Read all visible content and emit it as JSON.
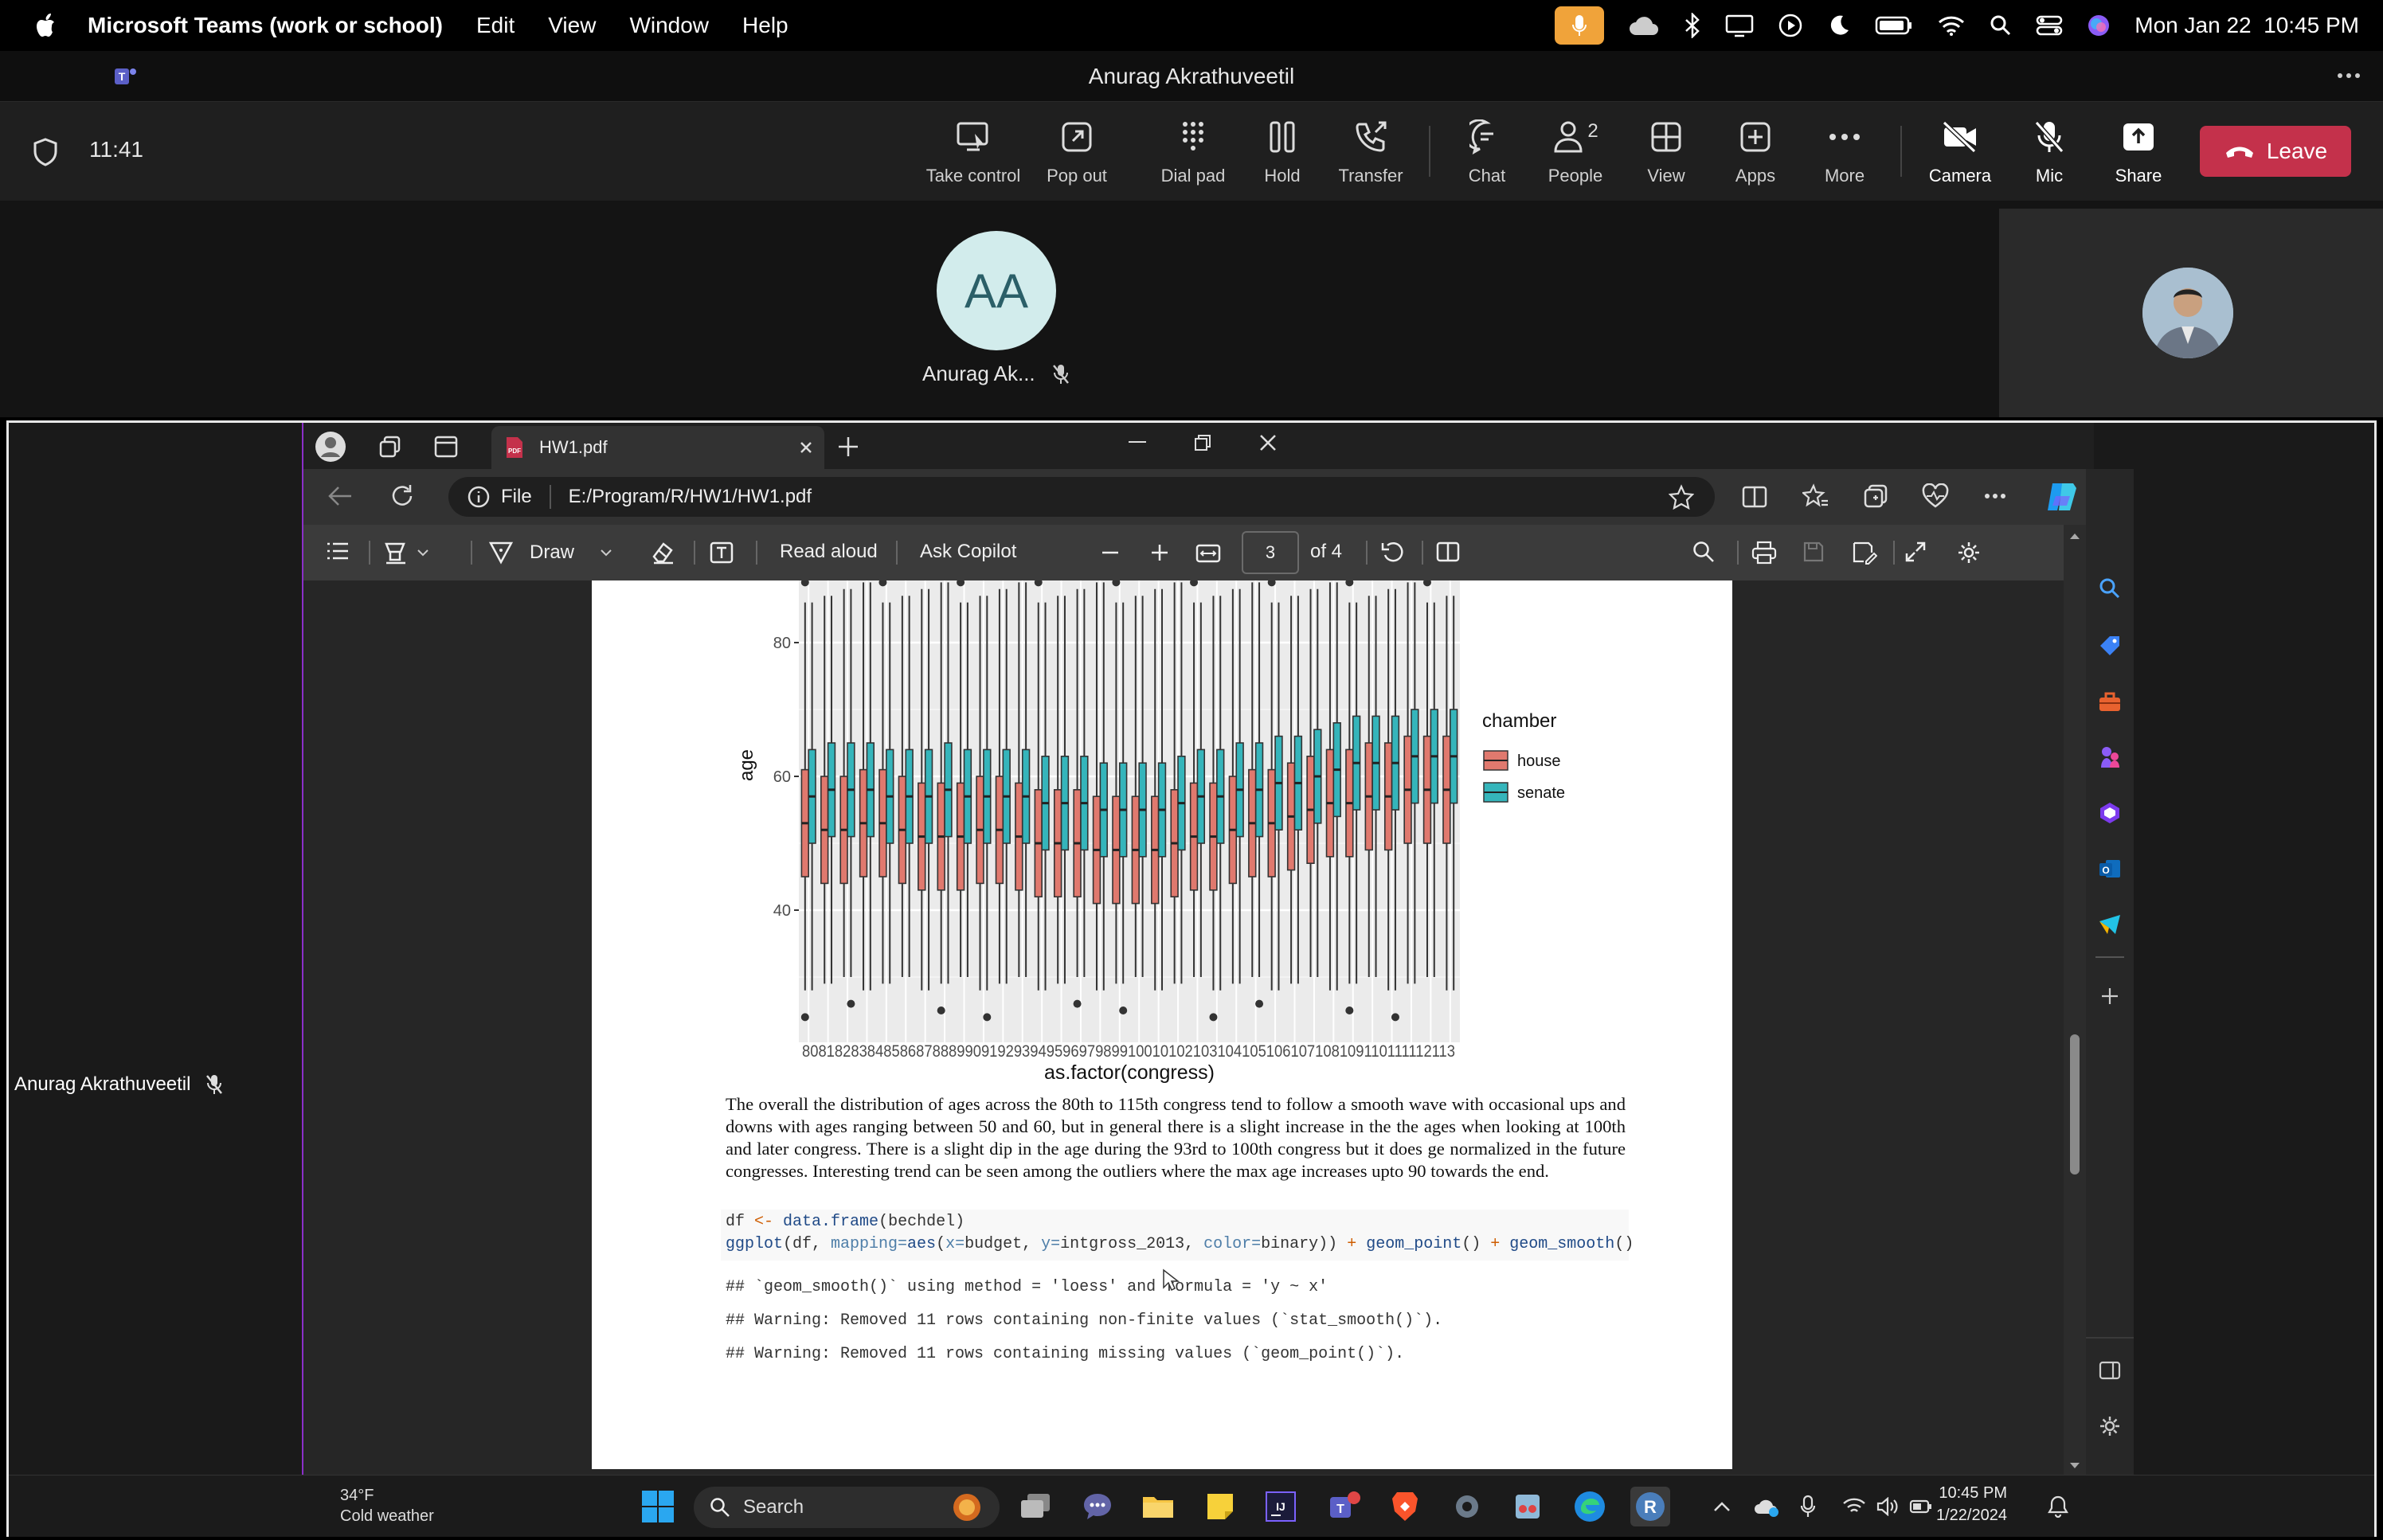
{
  "menubar": {
    "app_name": "Microsoft Teams (work or school)",
    "menus": [
      "Edit",
      "View",
      "Window",
      "Help"
    ],
    "datetime": "Mon Jan 22  10:45 PM"
  },
  "window": {
    "title": "Anurag Akrathuveetil"
  },
  "meeting": {
    "elapsed": "11:41",
    "controls": {
      "take_control": "Take control",
      "pop_out": "Pop out",
      "dial_pad": "Dial pad",
      "hold": "Hold",
      "transfer": "Transfer",
      "chat": "Chat",
      "people": "People",
      "people_count": "2",
      "view": "View",
      "apps": "Apps",
      "more": "More",
      "camera": "Camera",
      "mic": "Mic",
      "share": "Share",
      "leave": "Leave"
    },
    "participant": {
      "initials": "AA",
      "name": "Anurag Ak..."
    },
    "presenter_name": "Anurag Akrathuveetil"
  },
  "browser": {
    "tab_title": "HW1.pdf",
    "address_prefix": "File",
    "address": "E:/Program/R/HW1/HW1.pdf",
    "pdf_toolbar": {
      "draw": "Draw",
      "read_aloud": "Read aloud",
      "ask_copilot": "Ask Copilot",
      "page_current": "3",
      "page_total": "of 4"
    }
  },
  "document": {
    "paragraph": "The overall the distribution of ages across the 80th to 115th congress tend to follow a smooth wave with occasional ups and downs with ages ranging between 50 and 60, but in general there is a slight increase in the the ages when looking at 100th and later congress. There is a slight dip in the age during the 93rd to 100th congress but it does ge normalized in the future congresses. Interesting trend can be seen among the outliers where the max age increases upto 90 towards the end.",
    "code_line1_a": "df ",
    "code_line1_op": "<-",
    "code_line1_fn": " data.frame",
    "code_line1_b": "(bechdel)",
    "code_line2_fn": "ggplot",
    "code_line2_a": "(df, ",
    "code_line2_arg": "mapping=",
    "code_line2_fn2": "aes",
    "code_line2_b": "(",
    "code_line2_x": "x=",
    "code_line2_c": "budget, ",
    "code_line2_y": "y=",
    "code_line2_d": "intgross_2013, ",
    "code_line2_col": "color=",
    "code_line2_e": "binary)) ",
    "code_line2_plus1": "+",
    "code_line2_gp": " geom_point",
    "code_line2_f": "() ",
    "code_line2_plus2": "+",
    "code_line2_gs": " geom_smooth",
    "code_line2_g": "()",
    "output1": "## `geom_smooth()` using method = 'loess' and formula = 'y ~ x'",
    "output2": "## Warning: Removed 11 rows containing non-finite values (`stat_smooth()`).",
    "output3": "## Warning: Removed 11 rows containing missing values (`geom_point()`)."
  },
  "chart_data": {
    "type": "boxplot",
    "xlabel": "as.factor(congress)",
    "ylabel": "age",
    "y_ticks": [
      40,
      60,
      80
    ],
    "x_tick_text": "808182838485868788899091929394959697989910010102103104105106107108109110111112113",
    "legend_title": "chamber",
    "legend_position": "right",
    "grid": true,
    "categories": [
      "80",
      "81",
      "82",
      "83",
      "84",
      "85",
      "86",
      "87",
      "88",
      "89",
      "90",
      "91",
      "92",
      "93",
      "94",
      "95",
      "96",
      "97",
      "98",
      "99",
      "100",
      "101",
      "102",
      "103",
      "104",
      "105",
      "106",
      "107",
      "108",
      "109",
      "110",
      "111",
      "112",
      "113"
    ],
    "series": [
      {
        "name": "house",
        "color": "#e0796e",
        "median": [
          53,
          52,
          52,
          53,
          53,
          52,
          51,
          51,
          51,
          52,
          52,
          51,
          50,
          50,
          50,
          49,
          49,
          49,
          49,
          50,
          51,
          51,
          52,
          53,
          53,
          54,
          55,
          56,
          56,
          57,
          57,
          58,
          58,
          58
        ]
      },
      {
        "name": "senate",
        "color": "#35b5bb",
        "median": [
          57,
          58,
          58,
          58,
          57,
          57,
          57,
          58,
          57,
          57,
          57,
          57,
          56,
          56,
          56,
          55,
          55,
          55,
          55,
          56,
          57,
          57,
          58,
          58,
          59,
          59,
          60,
          61,
          62,
          62,
          62,
          63,
          63,
          63
        ]
      }
    ]
  },
  "taskbar": {
    "weather_temp": "34°F",
    "weather_desc": "Cold weather",
    "search": "Search",
    "time": "10:45 PM",
    "date": "1/22/2024"
  }
}
